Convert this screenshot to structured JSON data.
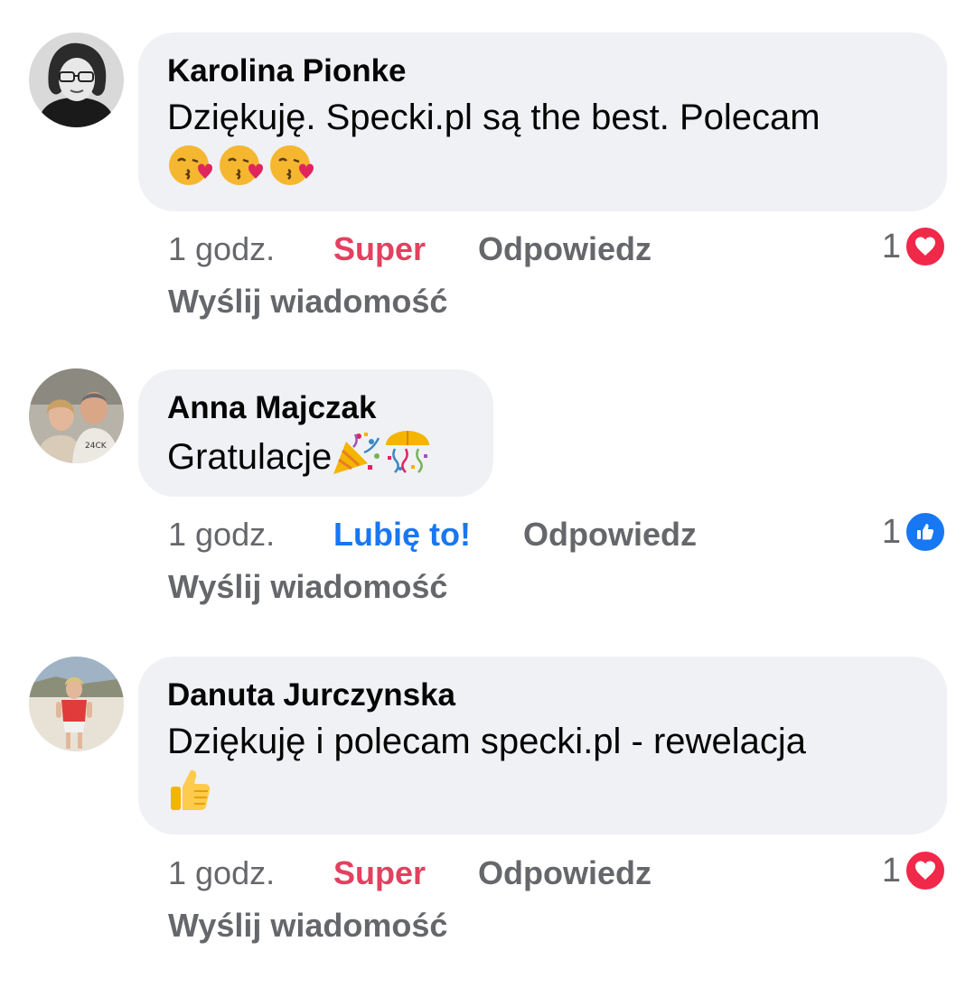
{
  "comments": [
    {
      "author": "Karolina Pionke",
      "text_line1": "Dziękuję. Specki.pl są the best. Polecam",
      "time": "1 godz.",
      "reaction_label": "Super",
      "reply_label": "Odpowiedz",
      "message_label": "Wyślij wiadomość",
      "reaction_count": "1",
      "reaction_icon": "heart-icon",
      "reaction_color": "#e4405f"
    },
    {
      "author": "Anna Majczak",
      "text_line1": "Gratulacje",
      "time": "1 godz.",
      "reaction_label": "Lubię to!",
      "reply_label": "Odpowiedz",
      "message_label": "Wyślij wiadomość",
      "reaction_count": "1",
      "reaction_icon": "thumbs-up-icon",
      "reaction_color": "#1877f2"
    },
    {
      "author": "Danuta Jurczynska",
      "text_line1": "Dziękuję i polecam specki.pl - rewelacja",
      "time": "1 godz.",
      "reaction_label": "Super",
      "reply_label": "Odpowiedz",
      "message_label": "Wyślij wiadomość",
      "reaction_count": "1",
      "reaction_icon": "heart-icon",
      "reaction_color": "#e4405f"
    }
  ]
}
